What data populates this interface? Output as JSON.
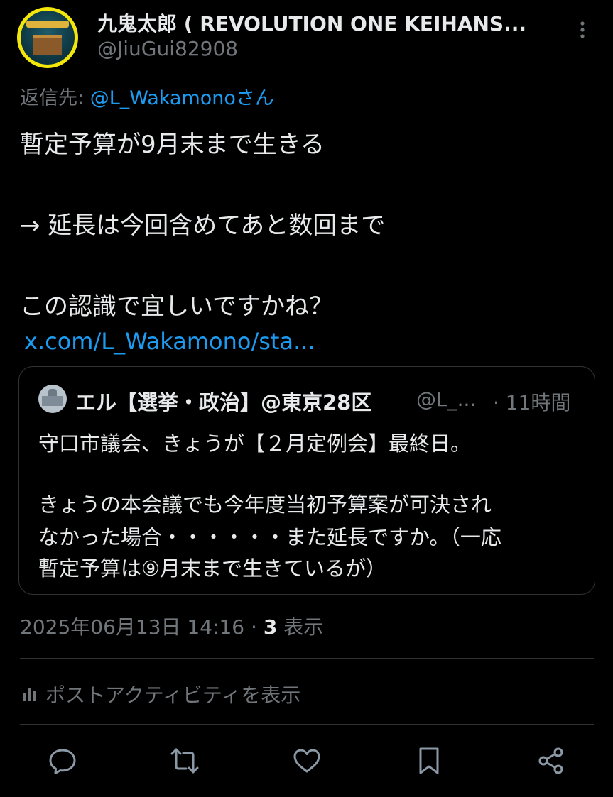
{
  "post": {
    "display_name": "九鬼太郎 ( REVOLUTION ONE KEIHANS...",
    "handle": "@JiuGui82908",
    "reply_to_prefix": "返信先: ",
    "reply_to_mention": "@L_Wakamonoさん",
    "body_lines": [
      "暫定予算が9月末まで生きる",
      "→ 延長は今回含めてあと数回まで",
      "この認識で宜しいですかね？"
    ],
    "link_text": "x.com/L_Wakamono/sta..."
  },
  "quote": {
    "name": "エル【選挙・政治】@東京28区",
    "handle": "@L_...",
    "time": "· 11時間",
    "lines": [
      "守口市議会、きょうが【２月定例会】最終日。",
      "きょうの本会議でも今年度当初予算案が可決され",
      "なかった場合・・・・・・また延長ですか。（一応",
      "暫定予算は⑨月末まで生きているが）"
    ]
  },
  "meta": {
    "timestamp": "2025年06月13日 14:16 · ",
    "views_count": "3",
    "views_label": " 表示"
  },
  "activity_label": "ポストアクティビティを表示",
  "actions": [
    "reply-icon",
    "retweet-icon",
    "like-icon",
    "bookmark-icon",
    "share-icon"
  ],
  "colors": {
    "background": "#000000",
    "text": "#e7e9ea",
    "muted": "#71767b",
    "link": "#1d9bf0",
    "border": "#2f3336"
  }
}
